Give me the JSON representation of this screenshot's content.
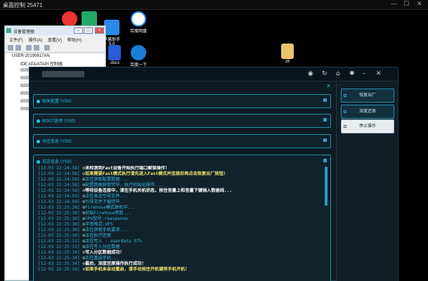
{
  "remote_title": "桌面控制 25471",
  "window_controls": [
    "—",
    "☐",
    "✕"
  ],
  "desktop": {
    "icons": [
      {
        "name": "ie-icon",
        "label": "",
        "color": "#e33"
      },
      {
        "name": "app-icon-1",
        "label": "",
        "color": "#2a6"
      },
      {
        "name": "assistant-icon",
        "label": "苹果助手\n5.0",
        "color": "#2a8ae8"
      },
      {
        "name": "cloud-icon",
        "label": "百度网盘",
        "color": "#fff"
      },
      {
        "name": "doc-icon",
        "label": ".docx",
        "color": "#2a5bd7"
      },
      {
        "name": "ie-icon-2",
        "label": "百度一下",
        "color": "#1a7ed8"
      },
      {
        "name": "folder-icon",
        "label": "z6",
        "color": "#e8c66a"
      }
    ]
  },
  "device_manager": {
    "title": "设备管理器",
    "menu": [
      "文件(F)",
      "操作(A)",
      "查看(V)",
      "帮助(H)"
    ],
    "tree": [
      {
        "text": "USER-20190617AN",
        "level": 1
      },
      {
        "text": "IDE ATA/ATAPI 控制器",
        "level": 2
      }
    ]
  },
  "app": {
    "panels": {
      "p1": "相关配置 (YS0)",
      "p2": "BOOT选项 (YS0)",
      "p3": "分区信息 (YS0)",
      "p4": "日志信息 (YS0)"
    },
    "log": [
      {
        "ts": "[12-03 22:24:58]",
        "msg": "未检测到Fast设备开始执行端口解锁操作！",
        "c": "white"
      },
      {
        "ts": "[12-03 22:24:58]",
        "msg": "如果需要Fast模式执行请先进入Fast模式并连接后再点击恢复出厂按钮！",
        "c": "yellow"
      },
      {
        "ts": "[12-03 22:24:58]",
        "msg": "正在获取配置数据...",
        "c": "cyan"
      },
      {
        "ts": "[12-03 22:24:58]",
        "msg": "配置数据获取完毕，执行初始化操作...",
        "c": "cyan"
      },
      {
        "ts": "[12-03 22:24:58]",
        "msg": "等待设备连接中，请在手机关机状态，按住音量上和音量下键插入数据线...",
        "c": "white"
      },
      {
        "ts": "[12-03 22:24:59]",
        "msg": "正在发送引导文件...",
        "c": "cyan"
      },
      {
        "ts": "[12-03 22:24:59]",
        "msg": "引导文件下载完毕",
        "c": "cyan"
      },
      {
        "ts": "[12-03 22:25:28]",
        "msg": "Firehose模式联机中...",
        "c": "cyan"
      },
      {
        "ts": "[12-03 22:25:30]",
        "msg": "初始Firehose参数...",
        "c": "cyan"
      },
      {
        "ts": "[12-03 22:25:30]",
        "msg": "CPU型号:reaspense",
        "c": "cyan"
      },
      {
        "ts": "[12-03 22:25:30]",
        "msg": "字串格式:UFS",
        "c": "cyan"
      },
      {
        "ts": "[12-03 22:25:30]",
        "msg": "正在获取手机要求...",
        "c": "cyan"
      },
      {
        "ts": "[12-03 22:25:30]",
        "msg": "正在执行还原",
        "c": "cyan"
      },
      {
        "ts": "[12-03 22:25:31]",
        "msg": "正在写入 - userdata 97%",
        "c": "cyan"
      },
      {
        "ts": "[12-03 22:25:31]",
        "msg": "正在写入分区数据",
        "c": "cyan"
      },
      {
        "ts": "[12-03 22:25:34]",
        "msg": "写入分区数据成功！",
        "c": "white"
      },
      {
        "ts": "[12-03 22:25:34]",
        "msg": "正在重启手机...",
        "c": "cyan"
      },
      {
        "ts": "[12-03 22:25:34]",
        "msg": "最后，深度还原操作执行成功！",
        "c": "white"
      },
      {
        "ts": "[12-03 22:25:34]",
        "msg": "如果手机未自动重启，请手动按住开机键将手机开机！",
        "c": "yellow"
      }
    ],
    "buttons": {
      "restore": "恢复出厂",
      "deep": "深度还原",
      "stop": "停止操作"
    }
  }
}
